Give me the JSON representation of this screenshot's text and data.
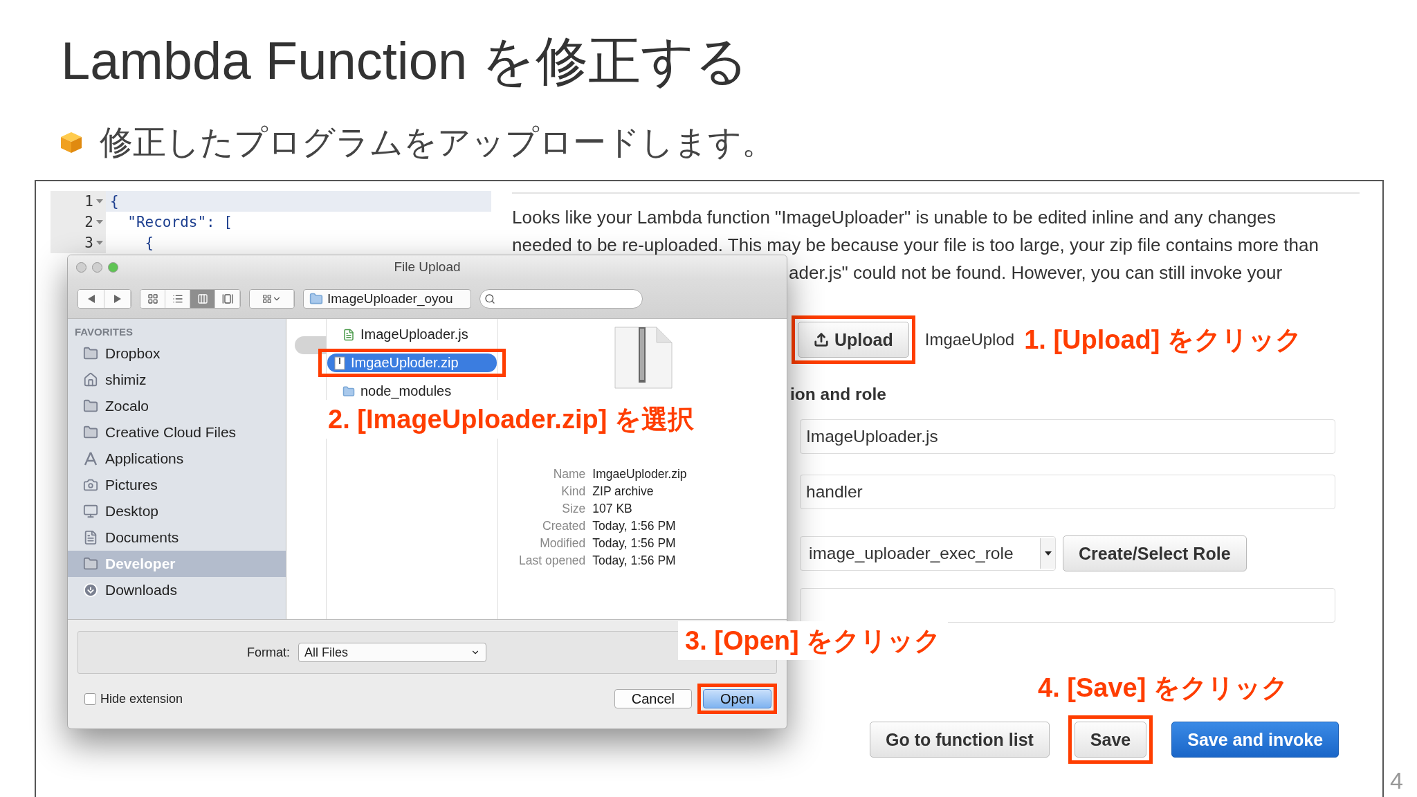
{
  "slide": {
    "title": "Lambda Function を修正する",
    "bullet": "修正したプログラムをアップロードします。",
    "page_number": "4"
  },
  "editor": {
    "lines": [
      {
        "number": "1",
        "text": "{",
        "current": true
      },
      {
        "number": "2",
        "text": "  \"Records\": [",
        "current": false
      },
      {
        "number": "3",
        "text": "    {",
        "current": false
      }
    ]
  },
  "lambda": {
    "notice_lines": [
      "Looks like your Lambda function \"ImageUploader\" is unable to be edited inline and any changes",
      "needed to be re-uploaded. This may be because your file is too large, your zip file contains more than",
      "ader.js\" could not be found. However, you can still invoke your"
    ],
    "upload_button": {
      "label": "Upload",
      "highlighted": true
    },
    "file_name": "ImgaeUplod",
    "section_heading": "ion and role",
    "fields": [
      {
        "value": "ImageUploader.js"
      },
      {
        "value": "handler"
      }
    ],
    "role_select": "image_uploader_exec_role",
    "role_button": "Create/Select Role",
    "buttons": [
      {
        "label": "Go to function list",
        "kind": "default",
        "highlighted": false
      },
      {
        "label": "Save",
        "kind": "default",
        "highlighted": true
      },
      {
        "label": "Save and invoke",
        "kind": "primary",
        "highlighted": false
      }
    ]
  },
  "dialog": {
    "title": "File Upload",
    "path": "ImageUploader_oyou",
    "view_modes": [
      {
        "kind": "icons",
        "selected": false
      },
      {
        "kind": "list",
        "selected": false
      },
      {
        "kind": "columns",
        "selected": true
      },
      {
        "kind": "coverflow",
        "selected": false
      }
    ],
    "sidebar": {
      "heading": "FAVORITES",
      "items": [
        {
          "label": "Dropbox",
          "kind": "folder",
          "selected": false
        },
        {
          "label": "shimiz",
          "kind": "home",
          "selected": false
        },
        {
          "label": "Zocalo",
          "kind": "folder",
          "selected": false
        },
        {
          "label": "Creative Cloud Files",
          "kind": "folder",
          "selected": false
        },
        {
          "label": "Applications",
          "kind": "apps",
          "selected": false
        },
        {
          "label": "Pictures",
          "kind": "camera",
          "selected": false
        },
        {
          "label": "Desktop",
          "kind": "desktop",
          "selected": false
        },
        {
          "label": "Documents",
          "kind": "documents",
          "selected": false
        },
        {
          "label": "Developer",
          "kind": "folder",
          "selected": true
        },
        {
          "label": "Downloads",
          "kind": "downloads",
          "selected": false
        }
      ]
    },
    "files": [
      {
        "name": "ImageUploader.js",
        "kind": "script",
        "selected": false,
        "highlighted": false
      },
      {
        "name": "ImgaeUploder.zip",
        "kind": "zip",
        "selected": true,
        "highlighted": true
      },
      {
        "name": "node_modules",
        "kind": "folder",
        "selected": false,
        "highlighted": false
      }
    ],
    "preview": {
      "info": [
        {
          "label": "Name",
          "value": "ImgaeUploder.zip"
        },
        {
          "label": "Kind",
          "value": "ZIP archive"
        },
        {
          "label": "Size",
          "value": "107 KB"
        },
        {
          "label": "Created",
          "value": "Today, 1:56 PM"
        },
        {
          "label": "Modified",
          "value": "Today, 1:56 PM"
        },
        {
          "label": "Last opened",
          "value": "Today, 1:56 PM"
        }
      ]
    },
    "format": {
      "label": "Format:",
      "value": "All Files"
    },
    "hide_extension": {
      "label": "Hide extension",
      "checked": false
    },
    "buttons": [
      {
        "label": "Cancel",
        "kind": "default",
        "highlighted": false
      },
      {
        "label": "Open",
        "kind": "primary",
        "highlighted": true
      }
    ]
  },
  "annotations": [
    "1. [Upload] をクリック",
    "2. [ImageUploader.zip] を選択",
    "3. [Open] をクリック",
    "4. [Save] をクリック"
  ]
}
